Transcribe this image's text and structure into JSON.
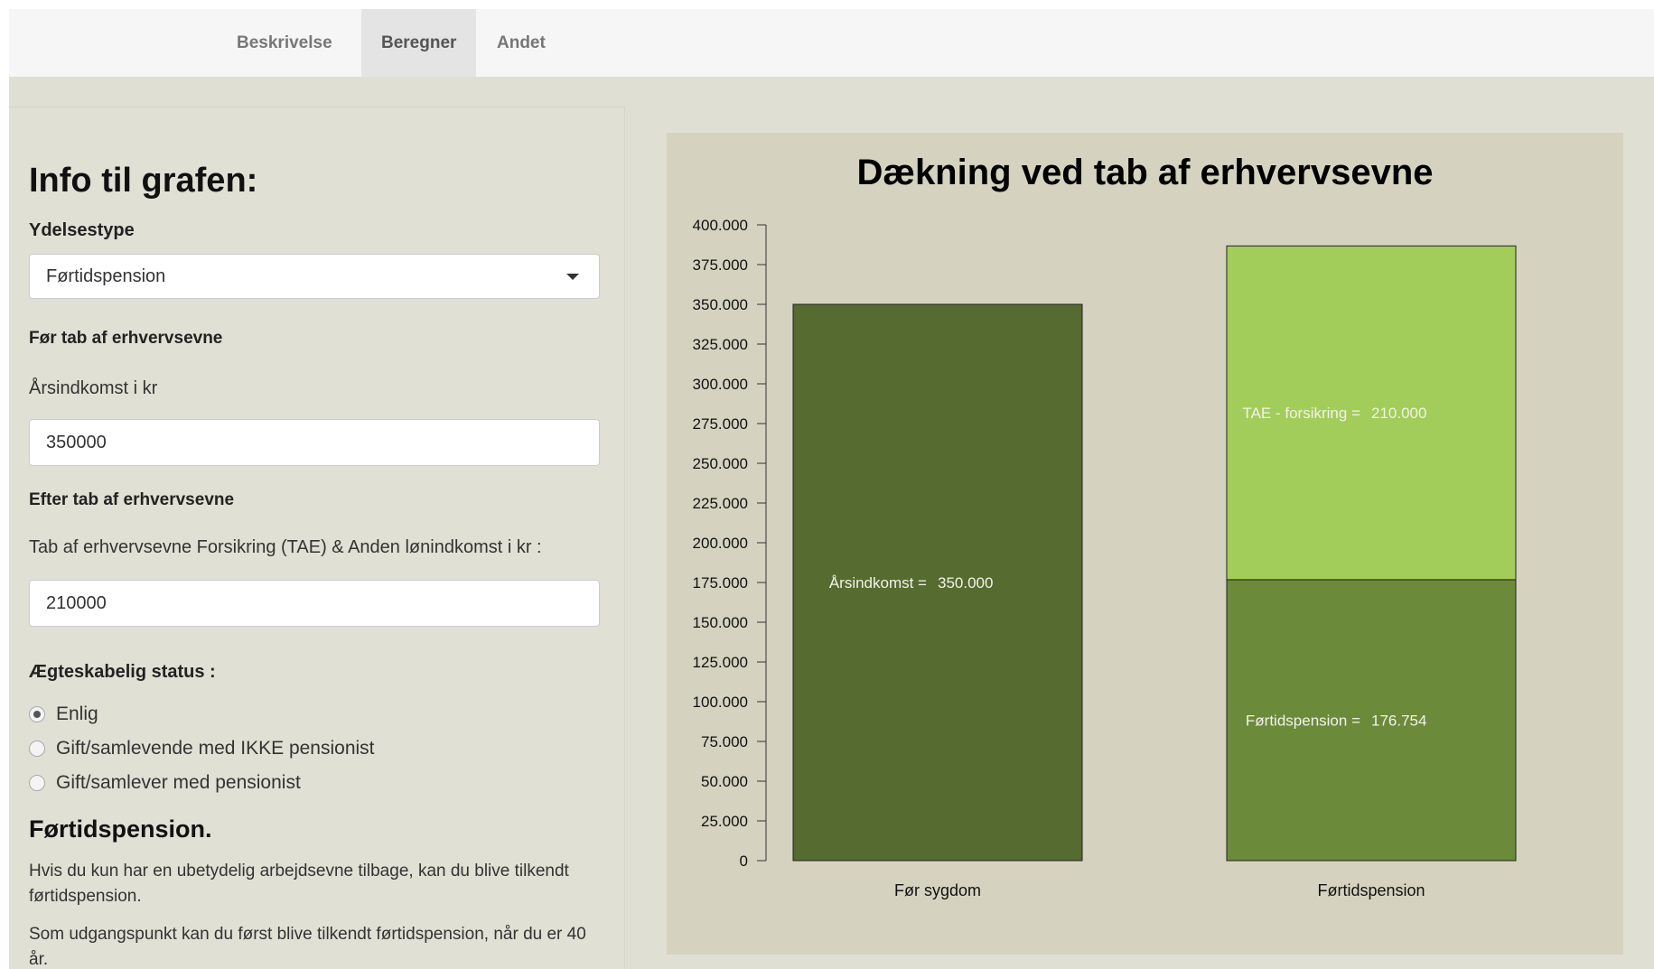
{
  "nav": {
    "tabs": [
      {
        "label": "Beskrivelse",
        "active": false
      },
      {
        "label": "Beregner",
        "active": true
      },
      {
        "label": "Andet",
        "active": false
      }
    ]
  },
  "sidebar": {
    "heading": "Info til grafen:",
    "ydelse_label": "Ydelsestype",
    "ydelse_value": "Førtidspension",
    "before_heading": "Før tab af erhvervsevne",
    "income_label": "Årsindkomst i kr",
    "income_value": "350000",
    "after_heading": "Efter tab af erhvervsevne",
    "tae_label": "Tab af erhvervsevne Forsikring (TAE) & Anden lønindkomst i kr :",
    "tae_value": "210000",
    "marital_label": "Ægteskabelig status :",
    "marital_options": [
      {
        "label": "Enlig",
        "checked": true
      },
      {
        "label": "Gift/samlevende med IKKE pensionist",
        "checked": false
      },
      {
        "label": "Gift/samlever med pensionist",
        "checked": false
      }
    ],
    "info_heading": "Førtidspension.",
    "info_paragraphs": [
      "Hvis du kun har en ubetydelig arbejdsevne tilbage, kan du blive tilkendt førtidspension.",
      "Som udgangspunkt kan du først blive tilkendt førtidspension, når du er 40 år."
    ]
  },
  "chart_data": {
    "type": "bar",
    "stacked": true,
    "title": "Dækning ved tab af erhvervsevne",
    "xlabel": "",
    "ylabel": "",
    "ylim": [
      0,
      400000
    ],
    "yticks": [
      "0",
      "25.000",
      "50.000",
      "75.000",
      "100.000",
      "125.000",
      "150.000",
      "175.000",
      "200.000",
      "225.000",
      "250.000",
      "275.000",
      "300.000",
      "325.000",
      "350.000",
      "375.000",
      "400.000"
    ],
    "ytick_values": [
      0,
      25000,
      50000,
      75000,
      100000,
      125000,
      150000,
      175000,
      200000,
      225000,
      250000,
      275000,
      300000,
      325000,
      350000,
      375000,
      400000
    ],
    "categories": [
      "Før sygdom",
      "Førtidspension"
    ],
    "bars": [
      {
        "category": "Før sygdom",
        "segments": [
          {
            "label": "Årsindkomst =",
            "value": 350000,
            "value_label": "350.000",
            "color": "#556b2f"
          }
        ]
      },
      {
        "category": "Førtidspension",
        "segments": [
          {
            "label": "Førtidspension =",
            "value": 176754,
            "value_label": "176.754",
            "color": "#6b8a3a"
          },
          {
            "label": "TAE - forsikring =",
            "value": 210000,
            "value_label": "210.000",
            "color": "#a2cd5a"
          }
        ]
      }
    ],
    "grid": false,
    "legend": "none"
  }
}
